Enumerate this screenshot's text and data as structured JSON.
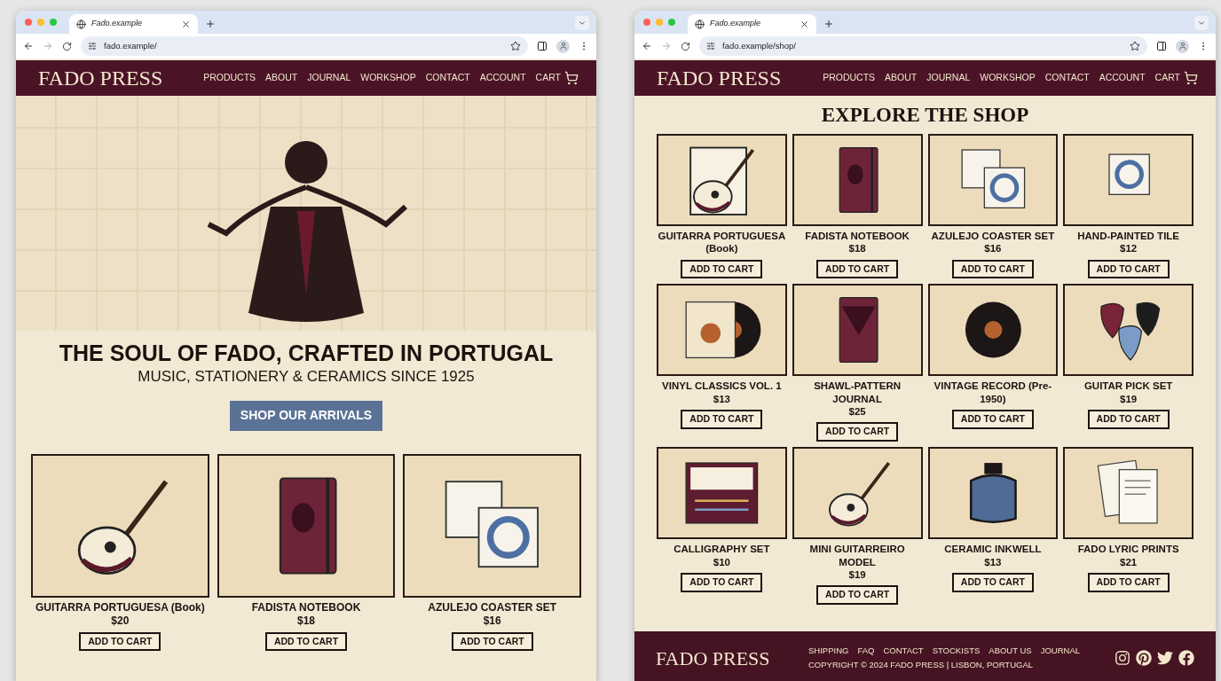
{
  "windows": [
    {
      "tab": {
        "title": "Fado.example"
      },
      "url": "fado.example/",
      "header": {
        "brand": "FADO PRESS",
        "nav": [
          "PRODUCTS",
          "ABOUT",
          "JOURNAL",
          "WORKSHOP",
          "CONTACT",
          "ACCOUNT"
        ],
        "cart": "CART"
      },
      "page": {
        "kind": "home",
        "hero": {
          "heading": "THE SOUL OF FADO, CRAFTED IN PORTUGAL",
          "subheading": "MUSIC, STATIONERY & CERAMICS SINCE 1925",
          "button": "SHOP OUR ARRIVALS"
        },
        "products": [
          {
            "name": "GUITARRA PORTUGUESA (Book)",
            "price": "$20",
            "button": "ADD TO CART",
            "kind": "lute"
          },
          {
            "name": "FADISTA NOTEBOOK",
            "price": "$18",
            "button": "ADD TO CART",
            "kind": "notebook"
          },
          {
            "name": "AZULEJO COASTER SET",
            "price": "$16",
            "button": "ADD TO CART",
            "kind": "tiles"
          }
        ]
      }
    },
    {
      "tab": {
        "title": "Fado.example"
      },
      "url": "fado.example/shop/",
      "header": {
        "brand": "FADO PRESS",
        "nav": [
          "PRODUCTS",
          "ABOUT",
          "JOURNAL",
          "WORKSHOP",
          "CONTACT",
          "ACCOUNT"
        ],
        "cart": "CART"
      },
      "page": {
        "kind": "shop",
        "title": "EXPLORE THE SHOP",
        "products": [
          {
            "name": "GUITARRA PORTUGUESA (Book)",
            "button": "ADD TO CART",
            "kind": "lute_book"
          },
          {
            "name": "FADISTA NOTEBOOK",
            "price": "$18",
            "button": "ADD TO CART",
            "kind": "notebook"
          },
          {
            "name": "AZULEJO COASTER SET",
            "price": "$16",
            "button": "ADD TO CART",
            "kind": "tiles"
          },
          {
            "name": "HAND-PAINTED TILE",
            "price": "$12",
            "button": "ADD TO CART",
            "kind": "tile"
          },
          {
            "name": "VINYL CLASSICS VOL. 1",
            "price": "$13",
            "button": "ADD TO CART",
            "kind": "vinyl"
          },
          {
            "name": "SHAWL-PATTERN JOURNAL",
            "price": "$25",
            "button": "ADD TO CART",
            "kind": "journal"
          },
          {
            "name": "VINTAGE RECORD (Pre-1950)",
            "button": "ADD TO CART",
            "kind": "record"
          },
          {
            "name": "GUITAR PICK SET",
            "price": "$19",
            "button": "ADD TO CART",
            "kind": "picks"
          },
          {
            "name": "CALLIGRAPHY SET",
            "price": "$10",
            "button": "ADD TO CART",
            "kind": "calligraphy"
          },
          {
            "name": "MINI GUITARREIRO MODEL",
            "price": "$19",
            "button": "ADD TO CART",
            "kind": "lute"
          },
          {
            "name": "CERAMIC INKWELL",
            "price": "$13",
            "button": "ADD TO CART",
            "kind": "inkwell"
          },
          {
            "name": "FADO LYRIC PRINTS",
            "price": "$21",
            "button": "ADD TO CART",
            "kind": "prints"
          }
        ],
        "footer": {
          "brand": "FADO PRESS",
          "links": [
            "SHIPPING",
            "FAQ",
            "CONTACT",
            "STOCKISTS",
            "ABOUT US",
            "JOURNAL"
          ],
          "copyright": "COPYRIGHT © 2024 FADO PRESS | LISBON, PORTUGAL",
          "social": [
            {
              "kind": "instagram"
            },
            {
              "kind": "pinterest"
            },
            {
              "kind": "twitter"
            },
            {
              "kind": "facebook"
            }
          ]
        }
      }
    }
  ]
}
